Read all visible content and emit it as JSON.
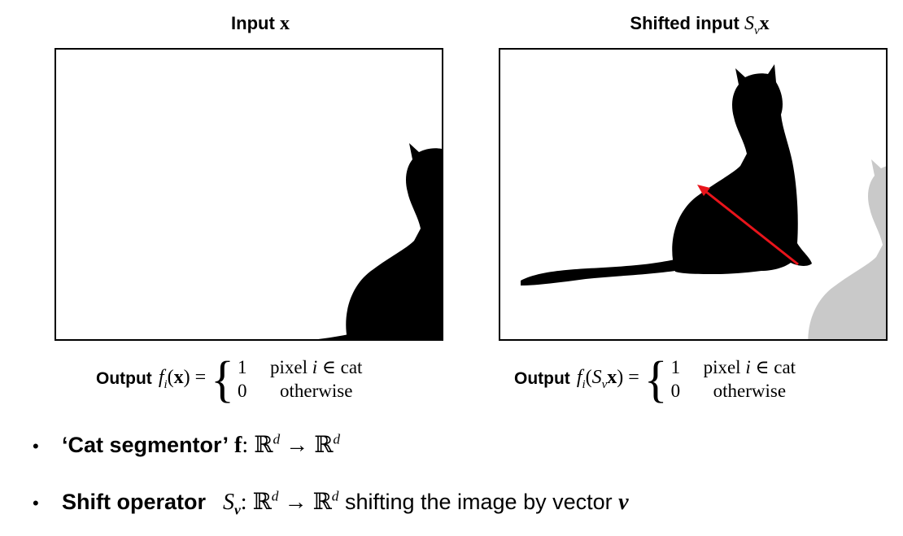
{
  "left_panel": {
    "title_text": "Input",
    "title_symbol": "x",
    "formula": {
      "label": "Output",
      "func": "f",
      "sub": "i",
      "arg": "x",
      "case1_value": "1",
      "case1_text": "pixel",
      "case1_var": "i",
      "case1_rest": "∈ cat",
      "case2_value": "0",
      "case2_text": "otherwise"
    }
  },
  "right_panel": {
    "title_text": "Shifted input",
    "title_op": "S",
    "title_sub": "v",
    "title_symbol": "x",
    "formula": {
      "label": "Output",
      "func": "f",
      "sub": "i",
      "arg_op": "S",
      "arg_sub": "v",
      "arg_symbol": "x",
      "case1_value": "1",
      "case1_text": "pixel",
      "case1_var": "i",
      "case1_rest": "∈ cat",
      "case2_value": "0",
      "case2_text": "otherwise"
    }
  },
  "bullets": [
    {
      "bold_text": "‘Cat segmentor’",
      "symbol": "f",
      "mapping_a": ": ℝ",
      "sup_a": "d",
      "arrow": " → ℝ",
      "sup_b": "d"
    },
    {
      "bold_text": "Shift operator",
      "op": "S",
      "op_sub": "v",
      "mapping_a": ": ℝ",
      "sup_a": "d",
      "arrow": " → ℝ",
      "sup_b": "d",
      "rest": " shifting the image by vector ",
      "vector": "v"
    }
  ],
  "colors": {
    "cat_silhouette": "#000000",
    "ghost_cat": "#c9c9c9",
    "arrow": "#e8141b"
  },
  "icons": {
    "bullet": "bullet-dot-icon",
    "arrow": "shift-arrow-icon"
  }
}
